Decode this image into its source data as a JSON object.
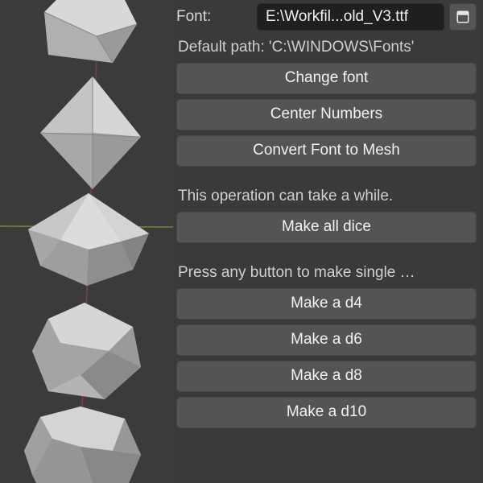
{
  "font_row": {
    "label": "Font:",
    "value": "E:\\Workfil...old_V3.ttf"
  },
  "default_path_text": "Default path: 'C:\\WINDOWS\\Fonts'",
  "buttons_top": {
    "change_font": "Change font",
    "center_numbers": "Center Numbers",
    "convert_font": "Convert Font to Mesh"
  },
  "warning_text": "This operation can take a while.",
  "make_all": "Make all dice",
  "single_hint": "Press any button to make single …",
  "make_buttons": {
    "d4": "Make a d4",
    "d6": "Make a d6",
    "d8": "Make a d8",
    "d10": "Make a d10"
  },
  "icons": {
    "file_browse": "file-open-icon"
  },
  "colors": {
    "panel_bg": "#3a3a3a",
    "button_bg": "#545454",
    "field_bg": "#1f1f1f",
    "axis_red": "#8b3a3a",
    "axis_green": "#5a7a3a"
  }
}
